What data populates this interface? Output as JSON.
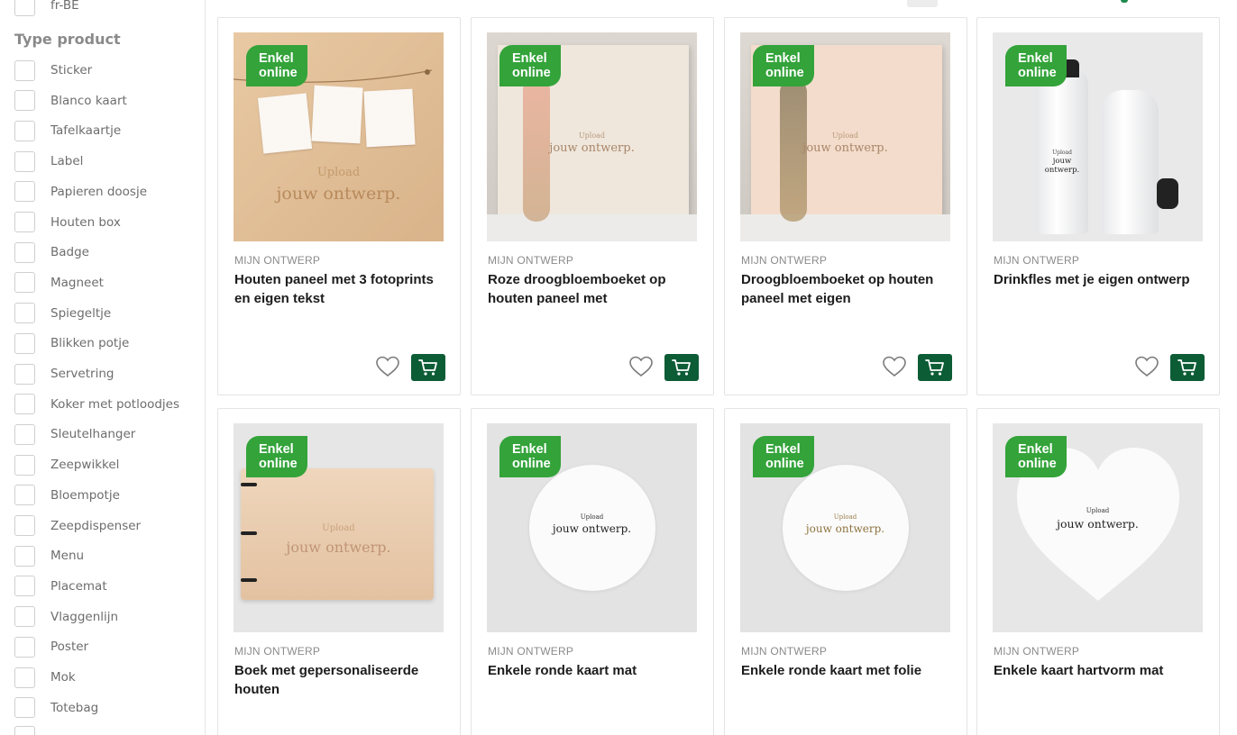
{
  "sidebar": {
    "top_item_label": "fr-BE",
    "section_title": "Type product",
    "items": [
      "Sticker",
      "Blanco kaart",
      "Tafelkaartje",
      "Label",
      "Papieren doosje",
      "Houten box",
      "Badge",
      "Magneet",
      "Spiegeltje",
      "Blikken potje",
      "Servetring",
      "Koker met potloodjes",
      "Sleutelhanger",
      "Zeepwikkel",
      "Bloempotje",
      "Zeepdispenser",
      "Menu",
      "Placemat",
      "Vlaggenlijn",
      "Poster",
      "Mok",
      "Totebag"
    ]
  },
  "products": [
    {
      "badge_line1": "Enkel",
      "badge_line2": "online",
      "brand": "MIJN ONTWERP",
      "title": "Houten paneel met 3 fotoprints en eigen tekst",
      "img_upload": "Upload",
      "img_text": "jouw ontwerp."
    },
    {
      "badge_line1": "Enkel",
      "badge_line2": "online",
      "brand": "MIJN ONTWERP",
      "title": "Roze droogbloemboeket op houten paneel met",
      "img_upload": "Upload",
      "img_text": "jouw ontwerp."
    },
    {
      "badge_line1": "Enkel",
      "badge_line2": "online",
      "brand": "MIJN ONTWERP",
      "title": "Droogbloemboeket op houten paneel met eigen",
      "img_upload": "Upload",
      "img_text": "jouw ontwerp."
    },
    {
      "badge_line1": "Enkel",
      "badge_line2": "online",
      "brand": "MIJN ONTWERP",
      "title": "Drinkfles met je eigen ontwerp",
      "img_upload": "Upload",
      "img_text": "jouw ontwerp."
    },
    {
      "badge_line1": "Enkel",
      "badge_line2": "online",
      "brand": "MIJN ONTWERP",
      "title": "Boek met gepersonaliseerde houten",
      "img_upload": "Upload",
      "img_text": "jouw ontwerp."
    },
    {
      "badge_line1": "Enkel",
      "badge_line2": "online",
      "brand": "MIJN ONTWERP",
      "title": "Enkele ronde kaart mat",
      "img_upload": "Upload",
      "img_text": "jouw ontwerp."
    },
    {
      "badge_line1": "Enkel",
      "badge_line2": "online",
      "brand": "MIJN ONTWERP",
      "title": "Enkele ronde kaart met folie",
      "img_upload": "Upload",
      "img_text": "jouw ontwerp."
    },
    {
      "badge_line1": "Enkel",
      "badge_line2": "online",
      "brand": "MIJN ONTWERP",
      "title": "Enkele kaart hartvorm mat",
      "img_upload": "Upload",
      "img_text": "jouw ontwerp."
    }
  ],
  "colors": {
    "badge_green": "#33a33a",
    "cart_green": "#0c5c35",
    "text_dark": "#1c1c1c",
    "text_muted": "#8b8b8b"
  },
  "icons": {
    "favorite": "heart-outline-icon",
    "cart": "shopping-cart-icon"
  }
}
